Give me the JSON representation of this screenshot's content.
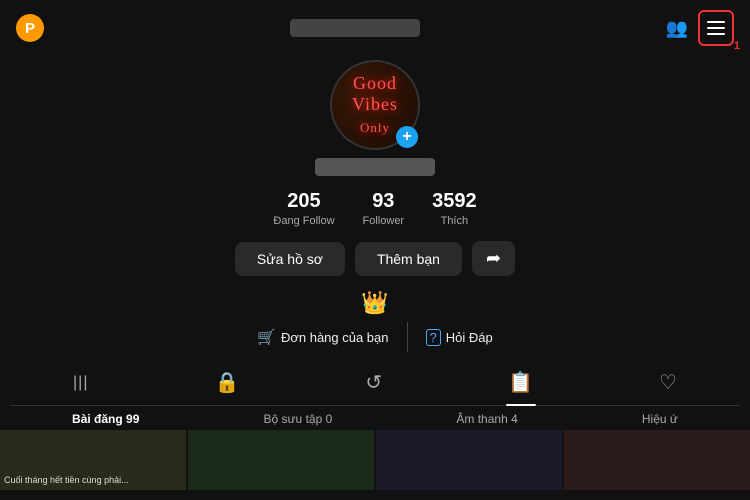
{
  "header": {
    "p_label": "P",
    "menu_label": "≡",
    "badge": "1",
    "persons_icon": "👤",
    "username_placeholder": ""
  },
  "profile": {
    "avatar_line1": "Good",
    "avatar_line2": "Vibes",
    "avatar_line3": "Only",
    "add_icon": "+",
    "username_placeholder": ""
  },
  "stats": [
    {
      "number": "205",
      "label": "Đang Follow"
    },
    {
      "number": "93",
      "label": "Follower"
    },
    {
      "number": "3592",
      "label": "Thích"
    }
  ],
  "actions": {
    "edit_btn": "Sửa hồ sơ",
    "add_friend_btn": "Thêm bạn",
    "share_icon": "➦"
  },
  "promo": {
    "crown_icon": "👑",
    "order_icon": "🛒",
    "order_label": "Đơn hàng của bạn",
    "qa_icon": "?",
    "qa_label": "Hỏi Đáp"
  },
  "tabs": [
    {
      "icon": "|||",
      "active": false
    },
    {
      "icon": "🔒",
      "active": false
    },
    {
      "icon": "↺",
      "active": false
    },
    {
      "icon": "📋",
      "active": true
    },
    {
      "icon": "♡",
      "active": false
    }
  ],
  "tab_labels": [
    {
      "label": "Bài đăng 99",
      "active": true
    },
    {
      "label": "Bộ sưu tập 0",
      "active": false
    },
    {
      "label": "Âm thanh 4",
      "active": false
    },
    {
      "label": "Hiệu ứ",
      "active": false
    }
  ],
  "thumbnails": [
    {
      "text": "Cuối tháng hết tiền cùng phải..."
    },
    {
      "text": ""
    },
    {
      "text": ""
    },
    {
      "text": ""
    }
  ]
}
